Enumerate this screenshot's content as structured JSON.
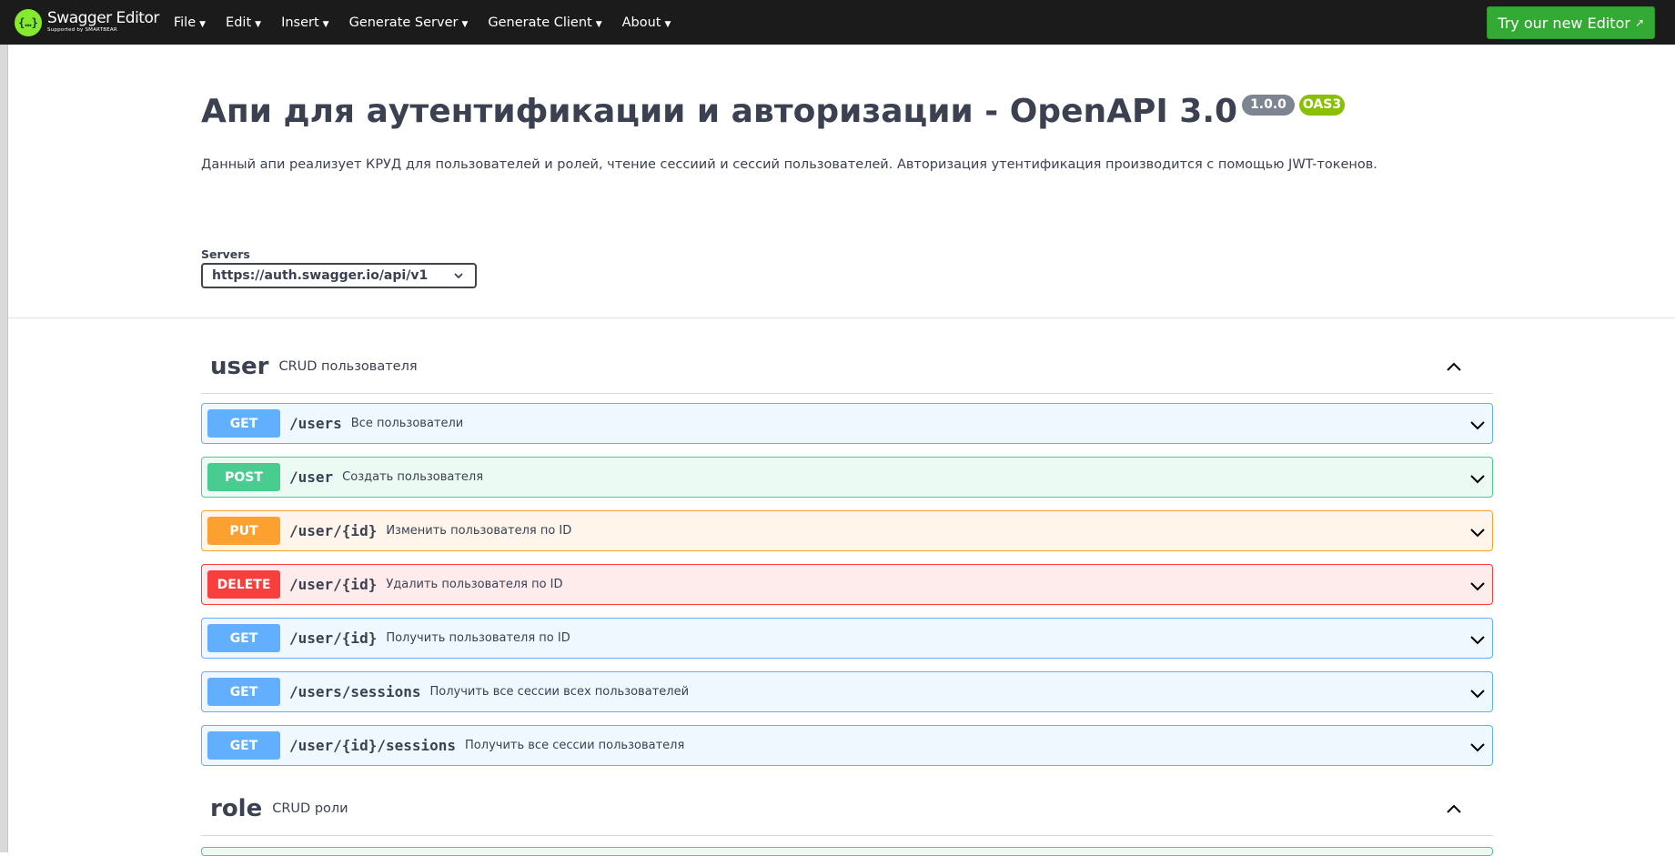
{
  "topbar": {
    "logo_glyph": "{…}",
    "logo_title": "Swagger Editor",
    "logo_subtitle": "Supported by SMARTBEAR",
    "menu": [
      {
        "label": "File"
      },
      {
        "label": "Edit"
      },
      {
        "label": "Insert"
      },
      {
        "label": "Generate Server"
      },
      {
        "label": "Generate Client"
      },
      {
        "label": "About"
      }
    ],
    "caret": "▼",
    "try_button": "Try our new Editor",
    "try_button_icon": "↗"
  },
  "info": {
    "title": "Апи для аутентификации и авторизации - OpenAPI 3.0",
    "version": "1.0.0",
    "oas_badge": "OAS3",
    "description": "Данный апи реализует КРУД для пользователей и ролей, чтение сессиий и сессий пользователей. Авторизация утентификация производится с помощью JWT-токенов."
  },
  "servers": {
    "label": "Servers",
    "selected": "https://auth.swagger.io/api/v1"
  },
  "tags": [
    {
      "name": "user",
      "description": "CRUD пользователя",
      "operations": [
        {
          "method": "GET",
          "path": "/users",
          "summary": "Все пользователи"
        },
        {
          "method": "POST",
          "path": "/user",
          "summary": "Создать пользователя"
        },
        {
          "method": "PUT",
          "path": "/user/{id}",
          "summary": "Изменить пользователя по ID"
        },
        {
          "method": "DELETE",
          "path": "/user/{id}",
          "summary": "Удалить пользователя по ID"
        },
        {
          "method": "GET",
          "path": "/user/{id}",
          "summary": "Получить пользователя по ID"
        },
        {
          "method": "GET",
          "path": "/users/sessions",
          "summary": "Получить все сессии всех пользователей"
        },
        {
          "method": "GET",
          "path": "/user/{id}/sessions",
          "summary": "Получить все сессии пользователя"
        }
      ]
    },
    {
      "name": "role",
      "description": "CRUD роли"
    }
  ],
  "colors": {
    "topbar_bg": "#1b1b1b",
    "try_button_bg": "#33aa33",
    "logo_green": "#85ea2d",
    "get": "#61affe",
    "post": "#49cc90",
    "put": "#fca130",
    "delete": "#f93e3e",
    "version_badge": "#7d8492",
    "oas_badge": "#89bf04"
  }
}
